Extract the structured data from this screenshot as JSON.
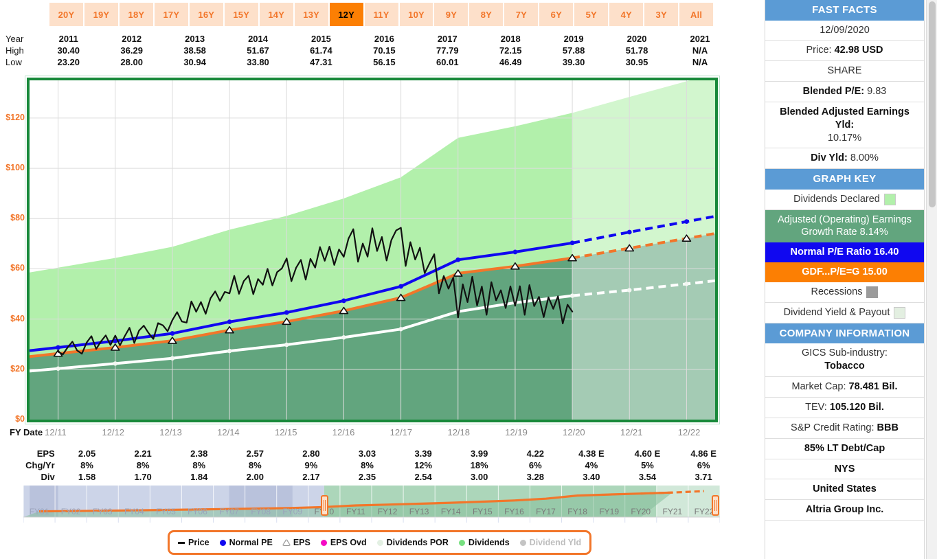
{
  "tabs": {
    "items": [
      "20Y",
      "19Y",
      "18Y",
      "17Y",
      "16Y",
      "15Y",
      "14Y",
      "13Y",
      "12Y",
      "11Y",
      "10Y",
      "9Y",
      "8Y",
      "7Y",
      "6Y",
      "5Y",
      "4Y",
      "3Y",
      "All"
    ],
    "active": "12Y"
  },
  "year_table": {
    "row_labels": [
      "Year",
      "High",
      "Low"
    ],
    "years": [
      "2011",
      "2012",
      "2013",
      "2014",
      "2015",
      "2016",
      "2017",
      "2018",
      "2019",
      "2020",
      "2021"
    ],
    "high": [
      "30.40",
      "36.29",
      "38.58",
      "51.67",
      "61.74",
      "70.15",
      "77.79",
      "72.15",
      "57.88",
      "51.78",
      "N/A"
    ],
    "low": [
      "23.20",
      "28.00",
      "30.94",
      "33.80",
      "47.31",
      "56.15",
      "60.01",
      "46.49",
      "39.30",
      "30.95",
      "N/A"
    ]
  },
  "fy_axis": {
    "title": "FY Date",
    "labels": [
      "12/11",
      "12/12",
      "12/13",
      "12/14",
      "12/15",
      "12/16",
      "12/17",
      "12/18",
      "12/19",
      "12/20",
      "12/21",
      "12/22"
    ]
  },
  "eps_table": {
    "row_labels": [
      "EPS",
      "Chg/Yr",
      "Div"
    ],
    "eps": [
      "2.05",
      "2.21",
      "2.38",
      "2.57",
      "2.80",
      "3.03",
      "3.39",
      "3.99",
      "4.22",
      "4.38 E",
      "4.60 E",
      "4.86 E"
    ],
    "chg_yr": [
      "8%",
      "8%",
      "8%",
      "8%",
      "9%",
      "8%",
      "12%",
      "18%",
      "6%",
      "4%",
      "5%",
      "6%"
    ],
    "div": [
      "1.58",
      "1.70",
      "1.84",
      "2.00",
      "2.17",
      "2.35",
      "2.54",
      "3.00",
      "3.28",
      "3.40",
      "3.54",
      "3.71"
    ]
  },
  "navigator": {
    "labels": [
      "FY01",
      "FY02",
      "FY03",
      "FY04",
      "FY05",
      "FY06",
      "FY07",
      "FY08",
      "FY09",
      "FY10",
      "FY11",
      "FY12",
      "FY13",
      "FY14",
      "FY15",
      "FY16",
      "FY17",
      "FY18",
      "FY19",
      "FY20",
      "FY21",
      "FY22"
    ],
    "selection_start_label": "FY10",
    "selection_end_label": "FY22"
  },
  "legend": {
    "items": [
      {
        "label": "Price",
        "marker": "dash-marker",
        "color": "#111111",
        "dim": false
      },
      {
        "label": "Normal PE",
        "marker": "blue-dot-marker",
        "color": "#1008f0",
        "dim": false
      },
      {
        "label": "EPS",
        "marker": "triangle-marker",
        "color": "#ffffff",
        "dim": false
      },
      {
        "label": "EPS Ovd",
        "marker": "magenta-dot-marker",
        "color": "#f50ac4",
        "dim": false
      },
      {
        "label": "Dividends POR",
        "marker": "pale-dot-marker",
        "color": "#e3f0e3",
        "dim": false
      },
      {
        "label": "Dividends",
        "marker": "green-dot-marker",
        "color": "#77e080",
        "dim": false
      },
      {
        "label": "Dividend Yld",
        "marker": "gray-dot-marker",
        "color": "#c4c4c4",
        "dim": true
      }
    ]
  },
  "sidebar": {
    "fast_facts": {
      "header": "FAST FACTS",
      "date": "12/09/2020",
      "price_label": "Price:",
      "price_value": "42.98 USD",
      "share": "SHARE",
      "blended_pe_label": "Blended P/E:",
      "blended_pe_value": "9.83",
      "blended_adj_label": "Blended Adjusted Earnings Yld:",
      "blended_adj_value": "10.17%",
      "div_yld_label": "Div Yld:",
      "div_yld_value": "8.00%"
    },
    "graph_key": {
      "header": "GRAPH KEY",
      "dividends_declared": "Dividends Declared",
      "earnings_growth": "Adjusted (Operating) Earnings Growth Rate 8.14%",
      "normal_pe": "Normal P/E Ratio 16.40",
      "gdf_peg": "GDF...P/E=G 15.00",
      "recessions": "Recessions",
      "div_yield_payout": "Dividend Yield & Payout"
    },
    "company_information": {
      "header": "COMPANY INFORMATION",
      "gics_label": "GICS Sub-industry:",
      "gics_value": "Tobacco",
      "market_cap_label": "Market Cap:",
      "market_cap_value": "78.481 Bil.",
      "tev_label": "TEV:",
      "tev_value": "105.120 Bil.",
      "sp_label": "S&P Credit Rating:",
      "sp_value": "BBB",
      "lt_debt": "85% LT Debt/Cap",
      "exchange": "NYS",
      "country": "United States",
      "company": "Altria Group Inc."
    }
  },
  "colors": {
    "accent_orange": "#fc7f03",
    "tab_bg": "#fde0ca",
    "header_blue": "#5b9bd5",
    "normal_pe_blue": "#1008f0",
    "earnings_green": "#62a57e",
    "dividends_light_green": "#b2f0ab",
    "plot_border_green": "#18893a"
  },
  "chart_data": {
    "type": "line",
    "title": "",
    "xlabel": "FY Date",
    "ylabel": "",
    "ylim": [
      0,
      135
    ],
    "yticks": [
      0,
      20,
      40,
      60,
      80,
      100,
      120
    ],
    "ytick_labels": [
      "$0",
      "$20",
      "$40",
      "$60",
      "$80",
      "$100",
      "$120"
    ],
    "grid": true,
    "legend_position": "bottom",
    "x": [
      "12/11",
      "12/12",
      "12/13",
      "12/14",
      "12/15",
      "12/16",
      "12/17",
      "12/18",
      "12/19",
      "12/20",
      "12/21",
      "12/22"
    ],
    "forecast_starts_at": "12/20",
    "series": [
      {
        "name": "Normal PE",
        "color": "#1008f0",
        "note": "EPS x Normal P/E 16.40",
        "values": [
          28.7,
          31.3,
          34.3,
          38.9,
          42.6,
          47.3,
          53.0,
          63.6,
          66.7,
          70.3,
          74.6,
          78.8
        ]
      },
      {
        "name": "EPS (P/E=G 15.00)",
        "color": "#f2762a",
        "note": "orange GDF P/E=G line, EPS x 15",
        "values": [
          26.3,
          28.7,
          31.4,
          35.6,
          39.0,
          43.3,
          48.5,
          58.2,
          61.0,
          64.3,
          68.2,
          72.1
        ]
      },
      {
        "name": "Dividends POR",
        "color": "#ffffff",
        "values": [
          20.3,
          22.3,
          24.4,
          27.3,
          29.8,
          32.7,
          36.0,
          43.0,
          46.5,
          49.3,
          51.5,
          54.0
        ]
      },
      {
        "name": "Price",
        "color": "#111111",
        "values": [
          27.0,
          31.4,
          38.1,
          51.5,
          58.2,
          67.5,
          70.7,
          49.4,
          49.9,
          42.98
        ]
      }
    ],
    "areas": [
      {
        "name": "Dividends Declared",
        "color": "#b2f0ab",
        "note": "light green upper band"
      },
      {
        "name": "Adjusted (Operating) Earnings",
        "color": "#62a57e",
        "note": "dark green lower band"
      }
    ]
  }
}
